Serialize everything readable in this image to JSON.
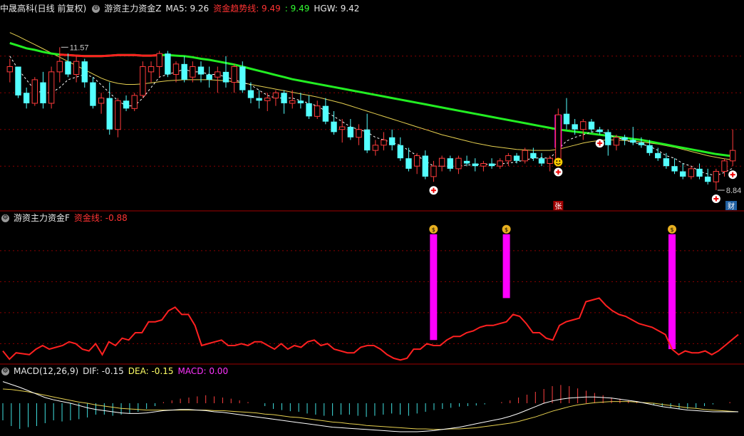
{
  "header1": {
    "stock": "中晟高科(日线 前复权)",
    "indicator": "游资主力资金Z",
    "ma5_label": "MA5: 9.26",
    "trend_label": "资金趋势线: 9.49",
    "trend_value2": ": 9.49",
    "hgw_label": "HGW: 9.42"
  },
  "header2": {
    "indicator": "游资主力资金F",
    "fund_label": "资金线: -0.88"
  },
  "header3": {
    "indicator": "MACD(12,26,9)",
    "dif": "DIF: -0.15",
    "dea": "DEA: -0.15",
    "macd": "MACD: 0.00"
  },
  "annotations": {
    "high_label": "11.57",
    "low_label": "8.84",
    "zhang_label": "张",
    "cai_label": "财"
  },
  "colors": {
    "up": "#ff3b3b",
    "down": "#54ffff",
    "ma_line": "#ffffff",
    "trend_green": "#22ee22",
    "trend_red": "#ff2020",
    "hgw": "#e6d050",
    "fund_line": "#ff2020",
    "magenta": "#ff00ff",
    "grid": "#8b0000"
  },
  "chart_data": [
    {
      "type": "candlestick",
      "name": "price",
      "ylim": [
        8.5,
        12.2
      ],
      "candles": [
        [
          11.1,
          11.35,
          10.9,
          11.2
        ],
        [
          11.2,
          11.1,
          10.6,
          10.65
        ],
        [
          10.7,
          10.8,
          10.4,
          10.5
        ],
        [
          10.5,
          11.0,
          10.45,
          10.95
        ],
        [
          10.9,
          11.1,
          10.4,
          10.5
        ],
        [
          10.5,
          11.2,
          10.4,
          11.1
        ],
        [
          11.1,
          11.57,
          10.9,
          11.3
        ],
        [
          11.3,
          11.45,
          11.0,
          11.05
        ],
        [
          11.05,
          11.4,
          10.9,
          11.3
        ],
        [
          11.3,
          11.35,
          10.8,
          10.9
        ],
        [
          10.9,
          11.0,
          10.4,
          10.45
        ],
        [
          10.5,
          10.7,
          10.3,
          10.6
        ],
        [
          10.6,
          10.9,
          9.9,
          10.0
        ],
        [
          10.0,
          10.6,
          9.85,
          10.55
        ],
        [
          10.55,
          10.65,
          10.35,
          10.4
        ],
        [
          10.4,
          10.7,
          10.35,
          10.65
        ],
        [
          10.65,
          11.3,
          10.6,
          11.2
        ],
        [
          11.1,
          11.3,
          10.9,
          11.2
        ],
        [
          11.2,
          11.5,
          11.0,
          11.45
        ],
        [
          11.45,
          11.5,
          11.0,
          11.05
        ],
        [
          11.05,
          11.3,
          10.9,
          11.25
        ],
        [
          11.25,
          11.4,
          10.9,
          10.95
        ],
        [
          11.0,
          11.3,
          10.9,
          11.2
        ],
        [
          11.2,
          11.3,
          10.9,
          11.05
        ],
        [
          11.05,
          11.2,
          10.8,
          10.95
        ],
        [
          11.0,
          11.2,
          10.7,
          11.1
        ],
        [
          11.1,
          11.4,
          10.8,
          10.9
        ],
        [
          10.9,
          11.25,
          10.7,
          11.2
        ],
        [
          11.2,
          11.3,
          10.7,
          10.75
        ],
        [
          10.75,
          10.9,
          10.5,
          10.6
        ],
        [
          10.6,
          10.75,
          10.4,
          10.55
        ],
        [
          10.55,
          10.7,
          10.35,
          10.6
        ],
        [
          10.6,
          10.75,
          10.45,
          10.7
        ],
        [
          10.7,
          10.75,
          10.3,
          10.5
        ],
        [
          10.5,
          10.75,
          10.4,
          10.55
        ],
        [
          10.55,
          10.7,
          10.4,
          10.5
        ],
        [
          10.5,
          10.65,
          10.2,
          10.25
        ],
        [
          10.25,
          10.55,
          10.2,
          10.45
        ],
        [
          10.45,
          10.6,
          10.1,
          10.15
        ],
        [
          10.15,
          10.35,
          9.9,
          9.95
        ],
        [
          10.0,
          10.2,
          9.75,
          10.05
        ],
        [
          10.05,
          10.2,
          9.8,
          9.85
        ],
        [
          9.85,
          10.1,
          9.7,
          10.0
        ],
        [
          10.0,
          10.3,
          9.55,
          9.6
        ],
        [
          9.6,
          9.8,
          9.5,
          9.7
        ],
        [
          9.7,
          9.95,
          9.6,
          9.8
        ],
        [
          9.85,
          10.0,
          9.6,
          9.7
        ],
        [
          9.7,
          9.85,
          9.4,
          9.45
        ],
        [
          9.45,
          9.65,
          9.2,
          9.25
        ],
        [
          9.3,
          9.55,
          9.15,
          9.5
        ],
        [
          9.5,
          9.6,
          9.05,
          9.1
        ],
        [
          9.1,
          9.4,
          9.0,
          9.3
        ],
        [
          9.3,
          9.5,
          9.2,
          9.45
        ],
        [
          9.45,
          9.5,
          9.2,
          9.25
        ],
        [
          9.25,
          9.5,
          9.15,
          9.45
        ],
        [
          9.4,
          9.5,
          9.3,
          9.35
        ],
        [
          9.35,
          9.45,
          9.2,
          9.3
        ],
        [
          9.3,
          9.4,
          9.2,
          9.35
        ],
        [
          9.35,
          9.45,
          9.25,
          9.3
        ],
        [
          9.3,
          9.45,
          9.25,
          9.4
        ],
        [
          9.4,
          9.55,
          9.3,
          9.5
        ],
        [
          9.5,
          9.55,
          9.35,
          9.4
        ],
        [
          9.4,
          9.65,
          9.35,
          9.6
        ],
        [
          9.55,
          9.65,
          9.4,
          9.45
        ],
        [
          9.45,
          9.55,
          9.3,
          9.35
        ],
        [
          9.35,
          9.5,
          9.2,
          9.45
        ],
        [
          9.4,
          10.4,
          9.35,
          10.28
        ],
        [
          10.3,
          10.6,
          10.0,
          10.1
        ],
        [
          10.1,
          10.2,
          9.9,
          10.0
        ],
        [
          10.0,
          10.2,
          9.8,
          10.15
        ],
        [
          10.15,
          10.2,
          9.95,
          10.0
        ],
        [
          10.0,
          10.05,
          9.9,
          9.95
        ],
        [
          9.95,
          10.0,
          9.5,
          9.7
        ],
        [
          9.7,
          9.9,
          9.6,
          9.85
        ],
        [
          9.85,
          9.9,
          9.7,
          9.8
        ],
        [
          9.8,
          10.05,
          9.7,
          9.75
        ],
        [
          9.75,
          9.85,
          9.65,
          9.7
        ],
        [
          9.7,
          9.8,
          9.5,
          9.55
        ],
        [
          9.55,
          9.65,
          9.4,
          9.45
        ],
        [
          9.45,
          9.55,
          9.25,
          9.3
        ],
        [
          9.3,
          9.45,
          9.15,
          9.2
        ],
        [
          9.2,
          9.35,
          9.05,
          9.1
        ],
        [
          9.1,
          9.3,
          9.05,
          9.25
        ],
        [
          9.25,
          9.35,
          9.05,
          9.1
        ],
        [
          9.1,
          9.25,
          8.95,
          9.0
        ],
        [
          9.0,
          9.25,
          8.84,
          9.2
        ],
        [
          9.2,
          9.45,
          9.1,
          9.4
        ],
        [
          9.4,
          10.0,
          9.3,
          9.6
        ]
      ],
      "ma5": [
        11.4,
        11.15,
        10.95,
        10.75,
        10.7,
        10.7,
        10.8,
        10.95,
        11.0,
        11.05,
        11.0,
        10.85,
        10.7,
        10.55,
        10.45,
        10.45,
        10.6,
        10.8,
        11.0,
        11.05,
        11.1,
        11.15,
        11.1,
        11.1,
        11.05,
        11.05,
        11.0,
        10.95,
        10.9,
        10.85,
        10.75,
        10.65,
        10.6,
        10.6,
        10.6,
        10.55,
        10.5,
        10.45,
        10.35,
        10.25,
        10.15,
        10.05,
        10.0,
        9.95,
        9.85,
        9.8,
        9.75,
        9.7,
        9.6,
        9.5,
        9.4,
        9.3,
        9.3,
        9.3,
        9.3,
        9.32,
        9.33,
        9.34,
        9.33,
        9.34,
        9.36,
        9.38,
        9.42,
        9.45,
        9.46,
        9.45,
        9.62,
        9.78,
        9.85,
        9.9,
        9.95,
        9.98,
        9.9,
        9.85,
        9.8,
        9.75,
        9.72,
        9.68,
        9.6,
        9.5,
        9.45,
        9.35,
        9.3,
        9.2,
        9.15,
        9.12,
        9.18,
        9.26
      ],
      "trend": [
        11.65,
        11.6,
        11.55,
        11.52,
        11.48,
        11.45,
        11.43,
        11.42,
        11.41,
        11.4,
        11.4,
        11.4,
        11.41,
        11.42,
        11.42,
        11.42,
        11.41,
        11.41,
        11.42,
        11.42,
        11.41,
        11.4,
        11.38,
        11.35,
        11.33,
        11.3,
        11.27,
        11.24,
        11.2,
        11.16,
        11.12,
        11.08,
        11.04,
        11.0,
        10.96,
        10.93,
        10.9,
        10.87,
        10.84,
        10.81,
        10.78,
        10.75,
        10.72,
        10.69,
        10.66,
        10.63,
        10.6,
        10.57,
        10.54,
        10.51,
        10.48,
        10.45,
        10.42,
        10.39,
        10.36,
        10.33,
        10.3,
        10.27,
        10.24,
        10.21,
        10.18,
        10.15,
        10.12,
        10.09,
        10.06,
        10.03,
        10.0,
        9.98,
        9.96,
        9.94,
        9.92,
        9.9,
        9.88,
        9.86,
        9.84,
        9.82,
        9.8,
        9.77,
        9.74,
        9.71,
        9.68,
        9.65,
        9.62,
        9.59,
        9.56,
        9.53,
        9.51,
        9.49
      ],
      "trend_red_ranges": [
        [
          6,
          18
        ]
      ],
      "hgw": [
        11.85,
        11.78,
        11.7,
        11.62,
        11.54,
        11.46,
        11.38,
        11.3,
        11.22,
        11.14,
        11.06,
        10.98,
        10.92,
        10.88,
        10.86,
        10.86,
        10.87,
        10.89,
        10.91,
        10.93,
        10.94,
        10.95,
        10.95,
        10.95,
        10.95,
        10.94,
        10.93,
        10.91,
        10.89,
        10.86,
        10.83,
        10.8,
        10.77,
        10.74,
        10.71,
        10.68,
        10.65,
        10.62,
        10.58,
        10.54,
        10.5,
        10.45,
        10.4,
        10.35,
        10.3,
        10.25,
        10.2,
        10.15,
        10.1,
        10.05,
        10.0,
        9.95,
        9.9,
        9.86,
        9.82,
        9.78,
        9.74,
        9.71,
        9.68,
        9.66,
        9.64,
        9.62,
        9.61,
        9.6,
        9.6,
        9.6,
        9.62,
        9.66,
        9.7,
        9.74,
        9.77,
        9.79,
        9.8,
        9.8,
        9.79,
        9.78,
        9.76,
        9.74,
        9.72,
        9.69,
        9.66,
        9.62,
        9.58,
        9.54,
        9.5,
        9.47,
        9.44,
        9.42
      ],
      "plus_markers": [
        51,
        66,
        71,
        85,
        87
      ],
      "smile_marker": 66,
      "magenta_bar": {
        "index": 66,
        "from": 9.65,
        "to": 10.28
      },
      "high_index": 6,
      "low_index": 85
    },
    {
      "type": "line",
      "name": "资金线",
      "ylim": [
        -1.0,
        6.5
      ],
      "values": [
        -0.4,
        -0.85,
        -0.5,
        -0.55,
        -0.6,
        -0.3,
        -0.1,
        -0.3,
        -0.2,
        -0.1,
        0.1,
        0.0,
        -0.3,
        -0.4,
        0.0,
        -0.6,
        0.1,
        -0.1,
        0.3,
        0.2,
        0.6,
        0.6,
        1.2,
        1.2,
        1.3,
        1.8,
        2.0,
        1.6,
        1.6,
        1.0,
        -0.1,
        0.0,
        0.1,
        0.2,
        -0.1,
        -0.1,
        0.0,
        -0.1,
        0.1,
        0.1,
        -0.1,
        -0.3,
        0.0,
        -0.3,
        -0.1,
        -0.2,
        0.1,
        0.2,
        -0.1,
        0.0,
        -0.3,
        -0.4,
        -0.5,
        -0.5,
        -0.2,
        -0.1,
        -0.1,
        -0.3,
        -0.6,
        -0.8,
        -0.9,
        -0.8,
        -0.3,
        -0.3,
        0.0,
        -0.1,
        -0.1,
        0.2,
        0.4,
        0.4,
        0.6,
        0.7,
        0.9,
        1.0,
        1.0,
        1.1,
        1.2,
        1.6,
        1.5,
        1.1,
        0.6,
        0.6,
        0.3,
        0.2,
        1.0,
        1.2,
        1.3,
        1.4,
        2.3,
        2.4,
        2.5,
        2.1,
        1.8,
        1.6,
        1.5,
        1.3,
        1.1,
        1.0,
        0.9,
        0.7,
        0.5,
        -0.3,
        -0.6,
        -0.4,
        -0.5,
        -0.5,
        -0.4,
        -0.6,
        -0.4,
        -0.1,
        0.2,
        0.5
      ],
      "magenta_bars": [
        {
          "index": 65,
          "from": 0.2,
          "to": 6.0
        },
        {
          "index": 76,
          "from": 2.5,
          "to": 6.0
        },
        {
          "index": 101,
          "from": -0.3,
          "to": 6.0
        }
      ]
    },
    {
      "type": "macd",
      "name": "MACD(12,26,9)",
      "ylim": [
        -0.55,
        0.45
      ],
      "hist": [
        -0.3,
        -0.4,
        -0.45,
        -0.42,
        -0.4,
        -0.35,
        -0.3,
        -0.32,
        -0.3,
        -0.28,
        -0.25,
        -0.2,
        -0.2,
        -0.22,
        -0.2,
        -0.18,
        -0.15,
        -0.1,
        -0.05,
        0.02,
        0.05,
        0.08,
        0.1,
        0.12,
        0.14,
        0.12,
        0.1,
        0.08,
        0.05,
        0.02,
        0.0,
        -0.05,
        -0.1,
        -0.12,
        -0.14,
        -0.15,
        -0.18,
        -0.2,
        -0.22,
        -0.22,
        -0.2,
        -0.2,
        -0.22,
        -0.24,
        -0.22,
        -0.2,
        -0.18,
        -0.2,
        -0.22,
        -0.18,
        -0.15,
        -0.12,
        -0.1,
        -0.08,
        -0.06,
        -0.05,
        -0.04,
        -0.02,
        0.0,
        0.02,
        0.05,
        0.1,
        0.15,
        0.2,
        0.25,
        0.3,
        0.32,
        0.3,
        0.26,
        0.22,
        0.18,
        0.14,
        0.1,
        0.08,
        0.05,
        0.03,
        0.0,
        -0.03,
        -0.06,
        -0.08,
        -0.1,
        -0.1,
        -0.08,
        -0.05,
        -0.02,
        0.0,
        0.02,
        0.0
      ],
      "dif": [
        0.38,
        0.33,
        0.28,
        0.22,
        0.16,
        0.1,
        0.06,
        0.03,
        0.0,
        -0.04,
        -0.08,
        -0.11,
        -0.13,
        -0.15,
        -0.17,
        -0.18,
        -0.18,
        -0.17,
        -0.15,
        -0.13,
        -0.12,
        -0.11,
        -0.11,
        -0.12,
        -0.13,
        -0.15,
        -0.16,
        -0.18,
        -0.2,
        -0.22,
        -0.24,
        -0.26,
        -0.28,
        -0.3,
        -0.32,
        -0.34,
        -0.36,
        -0.38,
        -0.4,
        -0.42,
        -0.43,
        -0.44,
        -0.45,
        -0.46,
        -0.47,
        -0.48,
        -0.49,
        -0.5,
        -0.5,
        -0.5,
        -0.49,
        -0.48,
        -0.46,
        -0.44,
        -0.42,
        -0.39,
        -0.36,
        -0.33,
        -0.3,
        -0.27,
        -0.23,
        -0.18,
        -0.12,
        -0.06,
        0.0,
        0.04,
        0.07,
        0.09,
        0.1,
        0.11,
        0.11,
        0.1,
        0.09,
        0.07,
        0.05,
        0.03,
        0.0,
        -0.03,
        -0.06,
        -0.08,
        -0.1,
        -0.12,
        -0.13,
        -0.14,
        -0.15,
        -0.15,
        -0.15,
        -0.15
      ],
      "dea": [
        0.25,
        0.24,
        0.22,
        0.2,
        0.17,
        0.14,
        0.11,
        0.08,
        0.05,
        0.02,
        0.0,
        -0.03,
        -0.05,
        -0.07,
        -0.09,
        -0.1,
        -0.11,
        -0.12,
        -0.12,
        -0.12,
        -0.12,
        -0.12,
        -0.12,
        -0.12,
        -0.12,
        -0.13,
        -0.13,
        -0.14,
        -0.15,
        -0.16,
        -0.17,
        -0.19,
        -0.2,
        -0.22,
        -0.24,
        -0.25,
        -0.27,
        -0.29,
        -0.31,
        -0.33,
        -0.34,
        -0.36,
        -0.37,
        -0.39,
        -0.4,
        -0.41,
        -0.42,
        -0.43,
        -0.44,
        -0.45,
        -0.45,
        -0.46,
        -0.46,
        -0.45,
        -0.45,
        -0.44,
        -0.43,
        -0.41,
        -0.39,
        -0.37,
        -0.35,
        -0.32,
        -0.28,
        -0.24,
        -0.19,
        -0.14,
        -0.1,
        -0.06,
        -0.03,
        -0.01,
        0.01,
        0.02,
        0.03,
        0.03,
        0.03,
        0.02,
        0.01,
        0.0,
        -0.02,
        -0.04,
        -0.06,
        -0.08,
        -0.09,
        -0.11,
        -0.12,
        -0.13,
        -0.14,
        -0.15
      ]
    }
  ]
}
